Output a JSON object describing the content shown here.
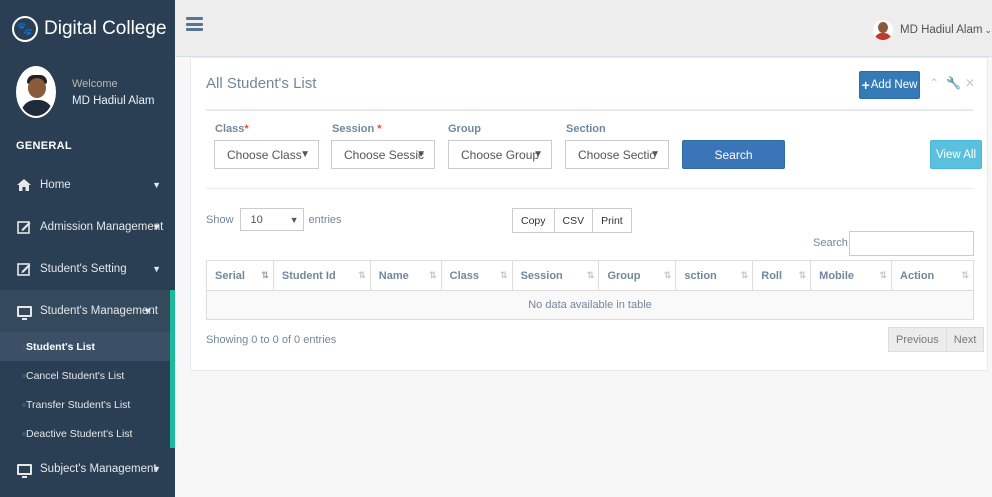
{
  "brand": {
    "title": "Digital College",
    "logo_icon": "paw-icon"
  },
  "profile": {
    "welcome": "Welcome",
    "name": "MD Hadiul Alam"
  },
  "sidebar": {
    "section": "GENERAL",
    "items": [
      {
        "label": "Home",
        "icon": "home-icon"
      },
      {
        "label": "Admission Management",
        "icon": "edit-icon"
      },
      {
        "label": "Student's Setting",
        "icon": "edit-icon"
      },
      {
        "label": "Student's Management",
        "icon": "monitor-icon",
        "children": [
          "Student's List",
          "Cancel Student's List",
          "Transfer Student's List",
          "Deactive Student's List"
        ]
      },
      {
        "label": "Subject's Management",
        "icon": "monitor-icon"
      }
    ],
    "active_child": "Student's List"
  },
  "topbar": {
    "user_name": "MD Hadiul Alam"
  },
  "panel": {
    "title": "All Student's List",
    "add_label": "Add New",
    "filters": {
      "class": {
        "label": "Class",
        "value": "Choose Class"
      },
      "session": {
        "label": "Session",
        "value": "Choose Sessic"
      },
      "group": {
        "label": "Group",
        "value": "Choose Group"
      },
      "section": {
        "label": "Section",
        "value": "Choose Sectio"
      }
    },
    "search_label": "Search",
    "view_all_label": "View All"
  },
  "datatable": {
    "show_label": "Show",
    "length_value": "10",
    "entries_label": "entries",
    "buttons": [
      "Copy",
      "CSV",
      "Print"
    ],
    "search_label": "Search:",
    "columns": [
      "Serial",
      "Student Id",
      "Name",
      "Class",
      "Session",
      "Group",
      "sction",
      "Roll",
      "Mobile",
      "Action"
    ],
    "empty_text": "No data available in table",
    "info": "Showing 0 to 0 of 0 entries",
    "prev_label": "Previous",
    "next_label": "Next"
  },
  "colors": {
    "sidebar_bg": "#2a3f54",
    "accent": "#1abb9c",
    "primary": "#337ab7",
    "info": "#5bc0de"
  }
}
